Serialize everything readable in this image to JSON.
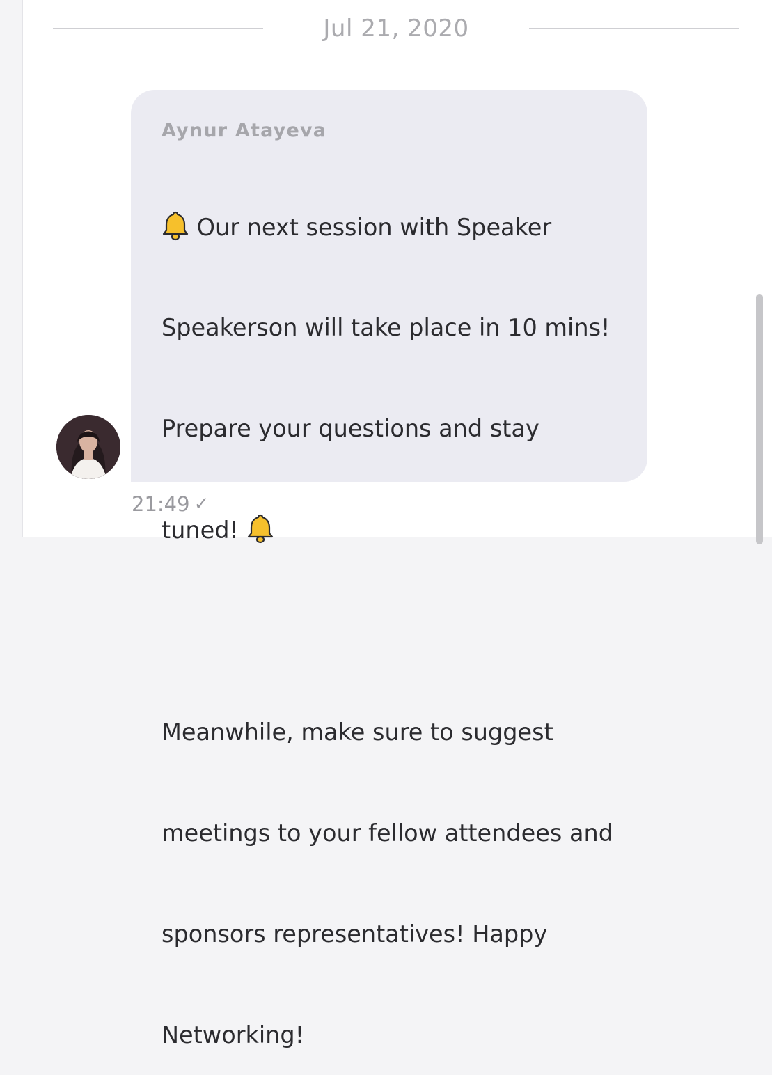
{
  "date_divider": {
    "label": "Jul 21, 2020"
  },
  "message": {
    "sender": "Aynur Atayeva",
    "lines": {
      "l1": "Our next session with Speaker",
      "l2": "Speakerson will take place in 10 mins!",
      "l3": "Prepare your questions and stay",
      "l4": "tuned!",
      "l5": "Meanwhile, make sure to suggest",
      "l6": "meetings to your fellow attendees and",
      "l7": "sponsors representatives! Happy",
      "l8": "Networking!"
    },
    "icons": [
      "bell-icon",
      "bell-icon"
    ],
    "time": "21:49",
    "status_icon": "check-icon",
    "status_glyph": "✓"
  },
  "colors": {
    "bubble": "#ebebf2",
    "sender": "#a6a6ab",
    "text": "#2b2b2f",
    "meta": "#9a9a9f",
    "bell": "#f6c02c"
  }
}
